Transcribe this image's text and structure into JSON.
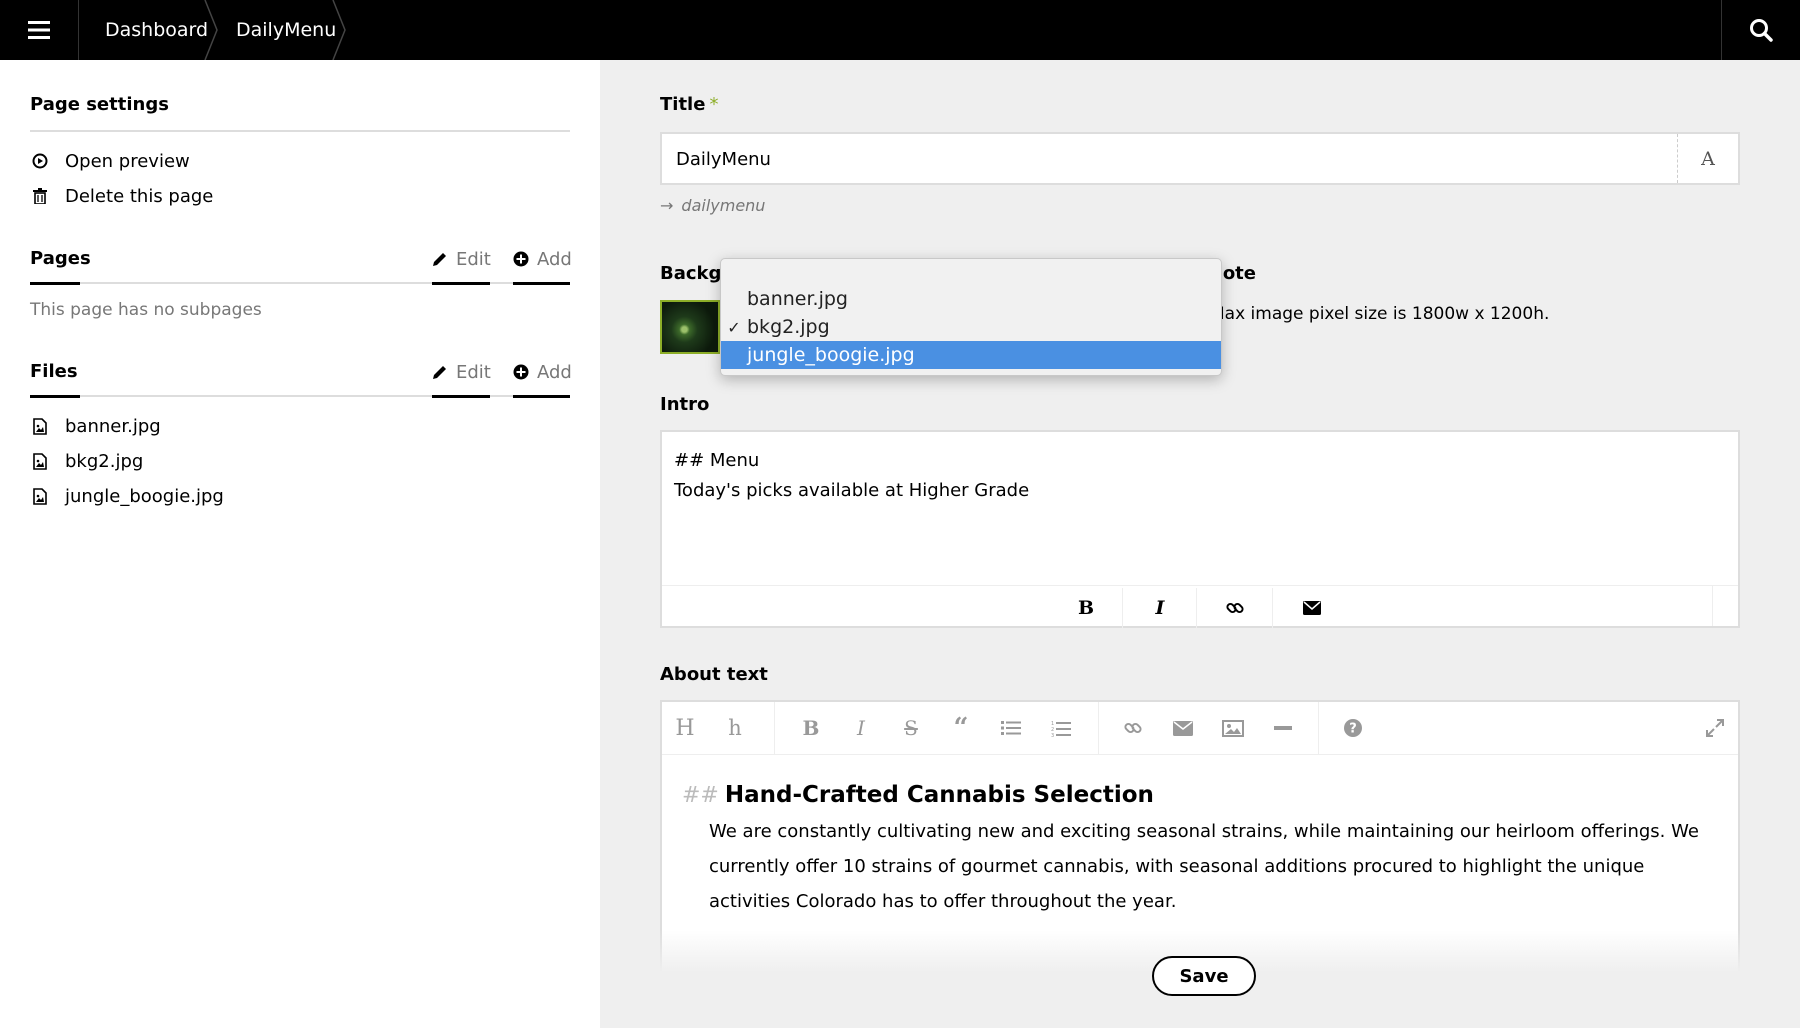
{
  "header": {
    "menu_icon": "hamburger-icon",
    "breadcrumbs": [
      "Dashboard",
      "DailyMenu"
    ],
    "search_icon": "search-icon"
  },
  "sidebar": {
    "page_settings": {
      "heading": "Page settings",
      "items": [
        {
          "label": "Open preview",
          "icon": "preview-icon"
        },
        {
          "label": "Delete this page",
          "icon": "trash-icon"
        }
      ]
    },
    "pages": {
      "heading": "Pages",
      "edit_label": "Edit",
      "add_label": "Add",
      "empty_text": "This page has no subpages"
    },
    "files": {
      "heading": "Files",
      "edit_label": "Edit",
      "add_label": "Add",
      "items": [
        "banner.jpg",
        "bkg2.jpg",
        "jungle_boogie.jpg"
      ]
    }
  },
  "form": {
    "title": {
      "label": "Title",
      "required_mark": "*",
      "value": "DailyMenu",
      "button_glyph": "A",
      "slug": "dailymenu"
    },
    "background": {
      "label": "Backgr",
      "options": [
        "banner.jpg",
        "bkg2.jpg",
        "jungle_boogie.jpg"
      ],
      "checked": "bkg2.jpg",
      "highlighted": "jungle_boogie.jpg"
    },
    "note": {
      "label": "Note",
      "text": "Max image pixel size is 1800w x 1200h."
    },
    "intro": {
      "label": "Intro",
      "text": "## Menu\nToday's picks available at Higher Grade",
      "toolbar": [
        "bold-icon",
        "italic-icon",
        "link-icon",
        "email-icon"
      ]
    },
    "about": {
      "label": "About text",
      "toolbar": [
        "heading-large-icon",
        "heading-small-icon",
        "bold-icon",
        "italic-icon",
        "strikethrough-icon",
        "quote-icon",
        "bullet-list-icon",
        "numbered-list-icon",
        "link-icon",
        "email-icon",
        "image-icon",
        "horizontal-rule-icon",
        "help-icon",
        "fullscreen-icon"
      ],
      "heading_marker": "##",
      "heading": "Hand-Crafted Cannabis Selection",
      "paragraph": "We are constantly cultivating new and exciting seasonal strains, while maintaining our heirloom offerings. We currently offer 10 strains of gourmet cannabis, with seasonal additions procured to highlight the unique activities Colorado has to offer throughout the year."
    },
    "save_label": "Save"
  },
  "colors": {
    "topbar": "#000000",
    "accent_green": "#8dae28",
    "selection_blue": "#4a90e2",
    "sidebar_bg": "#ffffff",
    "main_bg": "#efefef"
  }
}
